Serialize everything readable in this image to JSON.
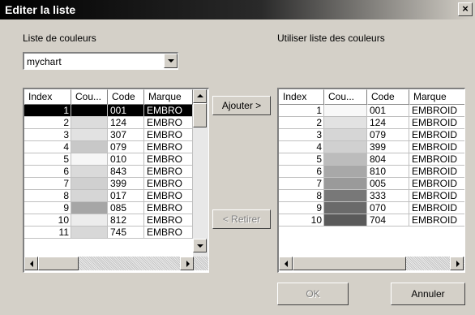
{
  "window": {
    "title": "Editer la liste",
    "close_glyph": "×"
  },
  "left": {
    "label": "Liste de couleurs",
    "combo_value": "mychart",
    "columns": [
      "Index",
      "Cou...",
      "Code",
      "Marque"
    ],
    "rows": [
      {
        "index": "1",
        "color": "#000000",
        "code": "001",
        "brand": "EMBRO",
        "selected": true
      },
      {
        "index": "2",
        "color": "#dcdcdc",
        "code": "124",
        "brand": "EMBRO"
      },
      {
        "index": "3",
        "color": "#e2e2e2",
        "code": "307",
        "brand": "EMBRO"
      },
      {
        "index": "4",
        "color": "#c8c8c8",
        "code": "079",
        "brand": "EMBRO"
      },
      {
        "index": "5",
        "color": "#f6f6f6",
        "code": "010",
        "brand": "EMBRO"
      },
      {
        "index": "6",
        "color": "#dadada",
        "code": "843",
        "brand": "EMBRO"
      },
      {
        "index": "7",
        "color": "#d0d0d0",
        "code": "399",
        "brand": "EMBRO"
      },
      {
        "index": "8",
        "color": "#d6d6d6",
        "code": "017",
        "brand": "EMBRO"
      },
      {
        "index": "9",
        "color": "#a6a6a6",
        "code": "085",
        "brand": "EMBRO"
      },
      {
        "index": "10",
        "color": "#ececec",
        "code": "812",
        "brand": "EMBRO"
      },
      {
        "index": "11",
        "color": "#d8d8d8",
        "code": "745",
        "brand": "EMBRO"
      }
    ]
  },
  "right": {
    "label": "Utiliser liste des couleurs",
    "columns": [
      "Index",
      "Cou...",
      "Code",
      "Marque"
    ],
    "rows": [
      {
        "index": "1",
        "color": "#f8f8f8",
        "code": "001",
        "brand": "EMBROID"
      },
      {
        "index": "2",
        "color": "#e2e2e2",
        "code": "124",
        "brand": "EMBROID"
      },
      {
        "index": "3",
        "color": "#d6d6d6",
        "code": "079",
        "brand": "EMBROID"
      },
      {
        "index": "4",
        "color": "#d0d0d0",
        "code": "399",
        "brand": "EMBROID"
      },
      {
        "index": "5",
        "color": "#bcbcbc",
        "code": "804",
        "brand": "EMBROID"
      },
      {
        "index": "6",
        "color": "#a8a8a8",
        "code": "810",
        "brand": "EMBROID"
      },
      {
        "index": "7",
        "color": "#9a9a9a",
        "code": "005",
        "brand": "EMBROID"
      },
      {
        "index": "8",
        "color": "#787878",
        "code": "333",
        "brand": "EMBROID"
      },
      {
        "index": "9",
        "color": "#6a6a6a",
        "code": "070",
        "brand": "EMBROID"
      },
      {
        "index": "10",
        "color": "#5a5a5a",
        "code": "704",
        "brand": "EMBROID"
      }
    ]
  },
  "buttons": {
    "add": "Ajouter >",
    "remove": "< Retirer",
    "ok": "OK",
    "cancel": "Annuler"
  }
}
